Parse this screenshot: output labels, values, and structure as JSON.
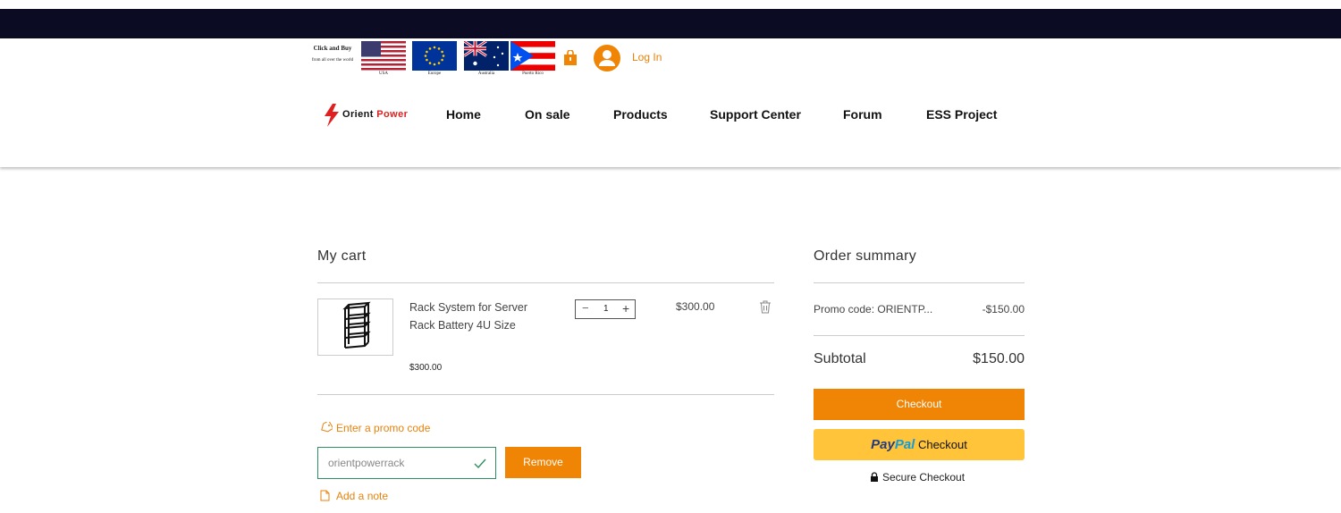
{
  "header": {
    "click_buy_line1": "Click and Buy",
    "click_buy_line2": "from all over the world",
    "flags": [
      {
        "label": "USA",
        "icon": "usa-flag-icon"
      },
      {
        "label": "Europe",
        "icon": "eu-flag-icon"
      },
      {
        "label": "Australia",
        "icon": "australia-flag-icon"
      },
      {
        "label": "Puerto Rico",
        "icon": "puerto-rico-flag-icon"
      }
    ],
    "login_label": "Log In",
    "logo_part1": "Orient",
    "logo_part2": "Power",
    "nav": [
      "Home",
      "On sale",
      "Products",
      "Support Center",
      "Forum",
      "ESS Project"
    ]
  },
  "cart": {
    "title": "My cart",
    "item": {
      "name": "Rack System for Server Rack Battery 4U Size",
      "unit_price": "$300.00",
      "quantity": "1",
      "line_total": "$300.00"
    },
    "promo_link": "Enter a promo code",
    "promo_value": "orientpowerrack",
    "remove_label": "Remove",
    "note_link": "Add a note"
  },
  "summary": {
    "title": "Order summary",
    "promo_label": "Promo code: ORIENTP...",
    "promo_amount": "-$150.00",
    "subtotal_label": "Subtotal",
    "subtotal_amount": "$150.00",
    "checkout_label": "Checkout",
    "paypal_pay": "Pay",
    "paypal_pal": "Pal",
    "paypal_checkout": "Checkout",
    "secure_label": "Secure Checkout"
  },
  "colors": {
    "accent": "#ef8405",
    "topbar": "#0b0b24",
    "paypal": "#ffc439",
    "valid": "#2f8e62"
  }
}
